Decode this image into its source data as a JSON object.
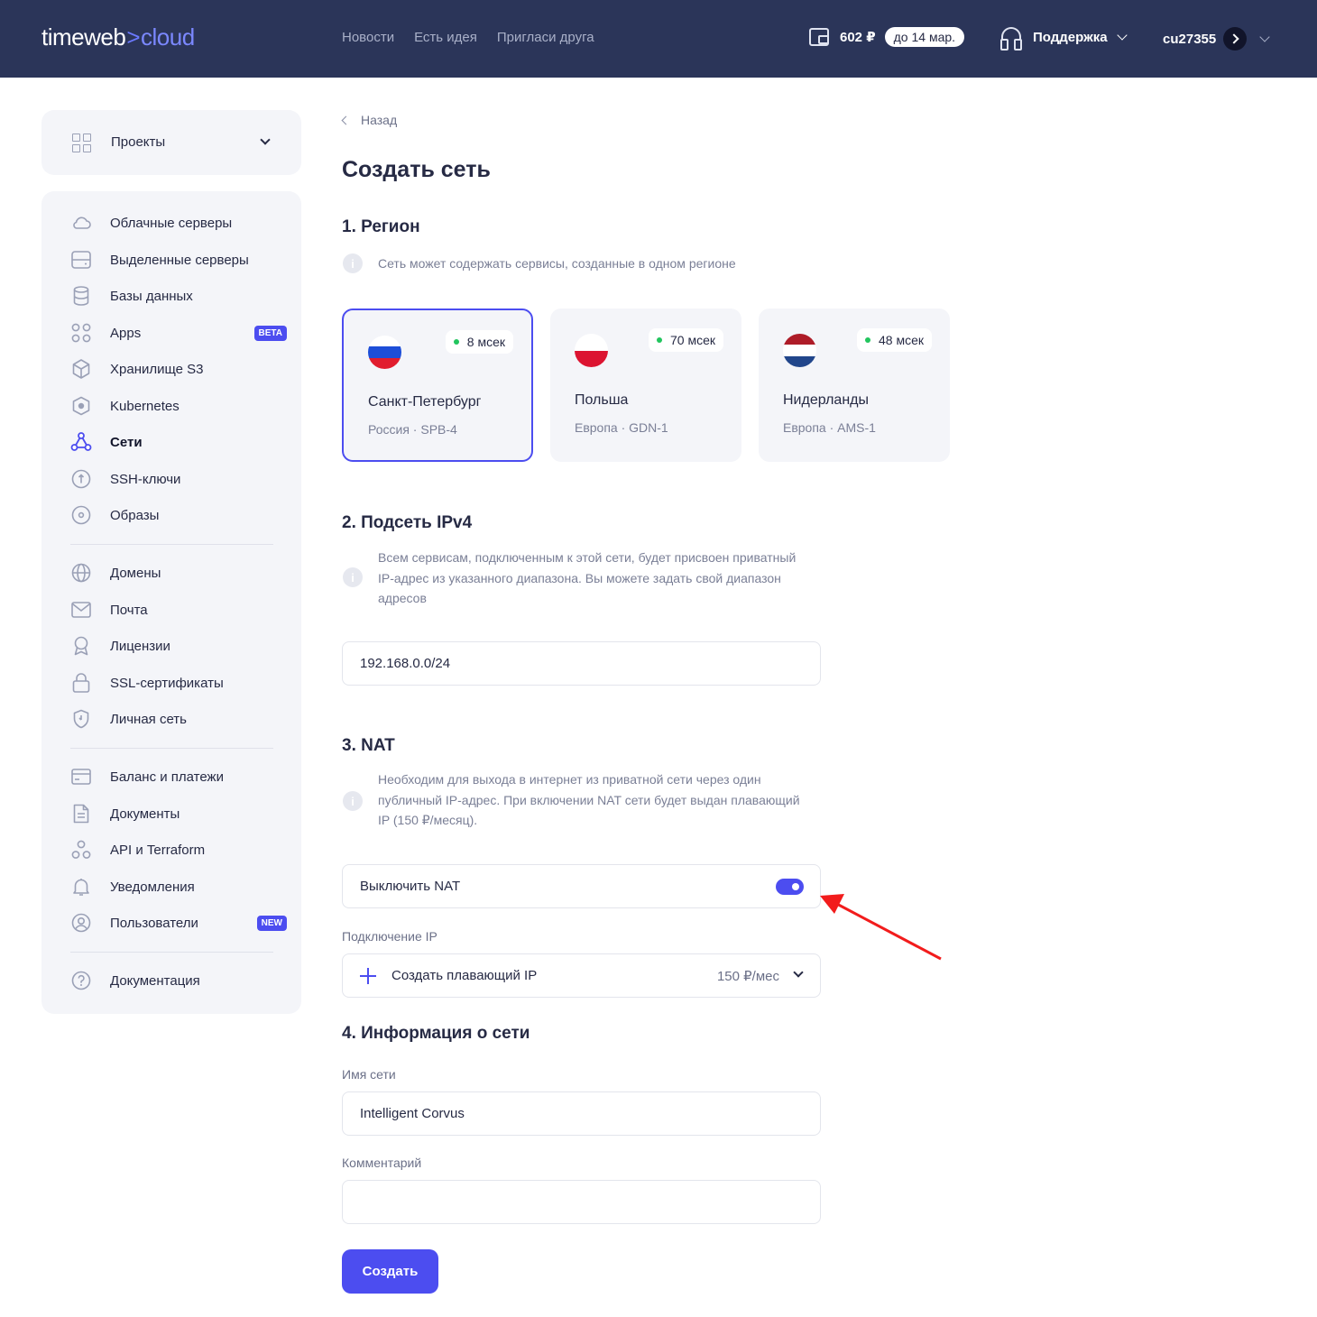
{
  "header": {
    "logo_main": "timeweb",
    "logo_sep": ">",
    "logo_accent": "cloud",
    "nav": [
      "Новости",
      "Есть идея",
      "Пригласи друга"
    ],
    "balance": "602 ₽",
    "until": "до 14 мар.",
    "support": "Поддержка",
    "user": "cu27355"
  },
  "sidebar": {
    "projects": "Проекты",
    "items": [
      {
        "label": "Облачные серверы",
        "icon": "cloud-icon"
      },
      {
        "label": "Выделенные серверы",
        "icon": "server-icon"
      },
      {
        "label": "Базы данных",
        "icon": "database-icon"
      },
      {
        "label": "Apps",
        "icon": "apps-icon",
        "tag": "BETA"
      },
      {
        "label": "Хранилище S3",
        "icon": "box-icon"
      },
      {
        "label": "Kubernetes",
        "icon": "kubernetes-icon"
      },
      {
        "label": "Сети",
        "icon": "network-icon",
        "active": true
      },
      {
        "label": "SSH-ключи",
        "icon": "key-icon"
      },
      {
        "label": "Образы",
        "icon": "disc-icon"
      },
      {
        "label": "Домены",
        "icon": "globe-icon"
      },
      {
        "label": "Почта",
        "icon": "mail-icon"
      },
      {
        "label": "Лицензии",
        "icon": "award-icon"
      },
      {
        "label": "SSL-сертификаты",
        "icon": "lock-icon"
      },
      {
        "label": "Личная сеть",
        "icon": "shield-icon"
      },
      {
        "label": "Баланс и платежи",
        "icon": "card-icon"
      },
      {
        "label": "Документы",
        "icon": "document-icon"
      },
      {
        "label": "API и Terraform",
        "icon": "api-icon"
      },
      {
        "label": "Уведомления",
        "icon": "bell-icon"
      },
      {
        "label": "Пользователи",
        "icon": "user-icon",
        "tag": "NEW"
      },
      {
        "label": "Документация",
        "icon": "help-icon"
      }
    ]
  },
  "main": {
    "back": "Назад",
    "title": "Создать сеть",
    "region": {
      "title": "1. Регион",
      "hint": "Сеть может содержать сервисы, созданные в одном регионе",
      "cards": [
        {
          "city": "Санкт-Петербург",
          "sub": "Россия · SPB-4",
          "ping": "8 мсек",
          "selected": true
        },
        {
          "city": "Польша",
          "sub": "Европа · GDN-1",
          "ping": "70 мсек"
        },
        {
          "city": "Нидерланды",
          "sub": "Европа · AMS-1",
          "ping": "48 мсек"
        }
      ]
    },
    "subnet": {
      "title": "2. Подсеть IPv4",
      "hint": "Всем сервисам, подключенным к этой сети, будет присвоен приватный IP-адрес из указанного диапазона. Вы можете задать свой диапазон адресов",
      "value": "192.168.0.0/24"
    },
    "nat": {
      "title": "3. NAT",
      "hint": "Необходим для выхода в интернет из приватной сети через один публичный IP-адрес. При включении NAT сети будет выдан плавающий IP (150 ₽/месяц).",
      "toggle_label": "Выключить NAT",
      "toggle_on": true,
      "ip_label": "Подключение IP",
      "ip_option": "Создать плавающий IP",
      "ip_price": "150 ₽/мес"
    },
    "info": {
      "title": "4. Информация о сети",
      "name_label": "Имя сети",
      "name_value": "Intelligent Corvus",
      "comment_label": "Комментарий",
      "comment_value": ""
    },
    "submit": "Создать"
  },
  "colors": {
    "header_bg": "#2b3559",
    "accent": "#4c4df0",
    "arrow": "#f21c1c"
  }
}
